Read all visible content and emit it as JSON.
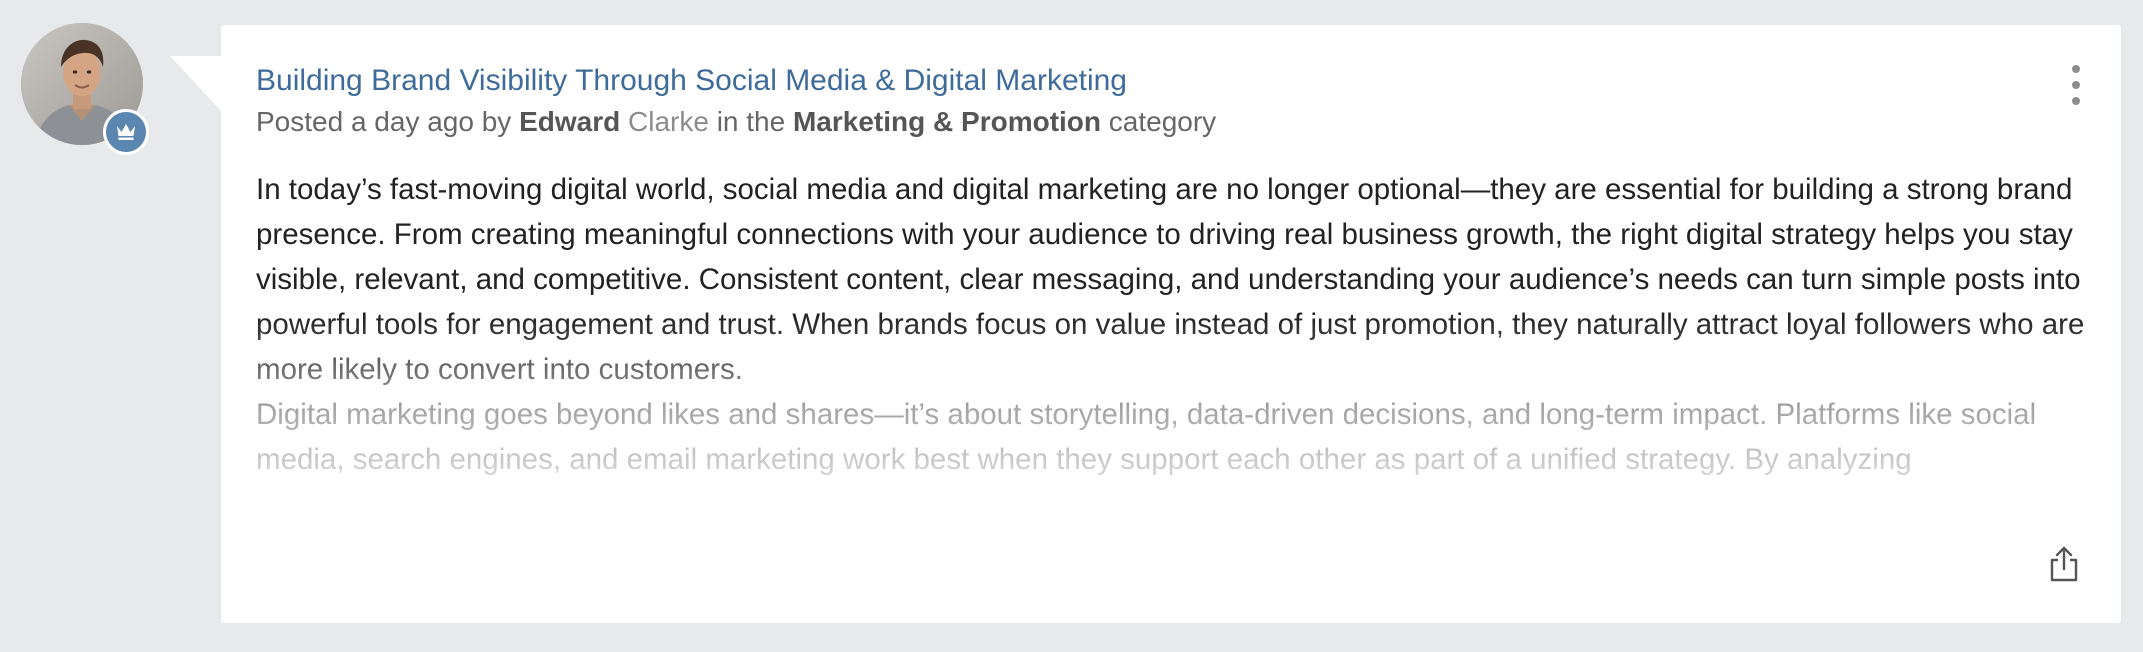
{
  "post": {
    "title": "Building Brand Visibility Through Social Media & Digital Marketing",
    "meta": {
      "posted": "Posted a day ago by",
      "author_first": "Edward",
      "author_last": "Clarke",
      "in_the": "in the",
      "category": "Marketing & Promotion",
      "category_suffix": "category"
    },
    "paragraphs": [
      "In today’s fast-moving digital world, social media and digital marketing are no longer optional—they are essential for building a strong brand presence. From creating meaningful connections with your audience to driving real business growth, the right digital strategy helps you stay visible, relevant, and competitive. Consistent content, clear messaging, and understanding your audience’s needs can turn simple posts into powerful tools for engagement and trust. When brands focus on value instead of just promotion, they naturally attract loyal followers who are more likely to convert into customers.",
      "Digital marketing goes beyond likes and shares—it’s about storytelling, data-driven decisions, and long-term impact. Platforms like social media, search engines, and email marketing work best when they support each other as part of a unified strategy. By analyzing"
    ]
  },
  "icons": {
    "avatar": "user-avatar",
    "badge": "crown-icon",
    "more": "more-vertical-icon",
    "share": "share-icon"
  },
  "colors": {
    "page_bg": "#e8e9eb",
    "card_bg": "#ffffff",
    "title": "#3f6b9a",
    "badge": "#5a86b0"
  }
}
